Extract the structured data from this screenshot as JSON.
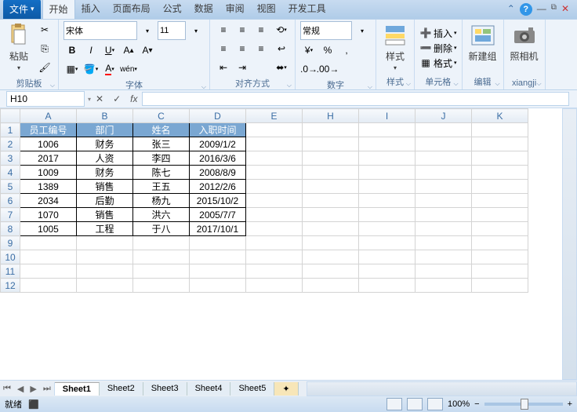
{
  "file_label": "文件",
  "tabs": [
    "开始",
    "插入",
    "页面布局",
    "公式",
    "数据",
    "审阅",
    "视图",
    "开发工具"
  ],
  "ribbon": {
    "clipboard": {
      "paste": "粘贴",
      "label": "剪贴板"
    },
    "font": {
      "name": "宋体",
      "size": "11",
      "label": "字体"
    },
    "align": {
      "label": "对齐方式"
    },
    "number": {
      "fmt": "常规",
      "label": "数字"
    },
    "style": {
      "btn": "样式",
      "label": "样式"
    },
    "cells": {
      "insert": "插入",
      "delete": "删除",
      "format": "格式",
      "label": "单元格"
    },
    "edit": {
      "btn": "新建组",
      "label": "编辑"
    },
    "camera": {
      "btn": "照相机",
      "label": "xiangji"
    }
  },
  "formula": {
    "cell": "H10"
  },
  "cols": [
    "A",
    "B",
    "C",
    "D",
    "E",
    "H",
    "I",
    "J",
    "K"
  ],
  "headers": [
    "员工编号",
    "部门",
    "姓名",
    "入职时间"
  ],
  "data": [
    [
      "1006",
      "财务",
      "张三",
      "2009/1/2"
    ],
    [
      "2017",
      "人资",
      "李四",
      "2016/3/6"
    ],
    [
      "1009",
      "财务",
      "陈七",
      "2008/8/9"
    ],
    [
      "1389",
      "销售",
      "王五",
      "2012/2/6"
    ],
    [
      "2034",
      "后勤",
      "杨九",
      "2015/10/2"
    ],
    [
      "1070",
      "销售",
      "洪六",
      "2005/7/7"
    ],
    [
      "1005",
      "工程",
      "于八",
      "2017/10/1"
    ]
  ],
  "sheets": [
    "Sheet1",
    "Sheet2",
    "Sheet3",
    "Sheet4",
    "Sheet5"
  ],
  "status": {
    "ready": "就绪",
    "macro": "",
    "zoom": "100%"
  }
}
